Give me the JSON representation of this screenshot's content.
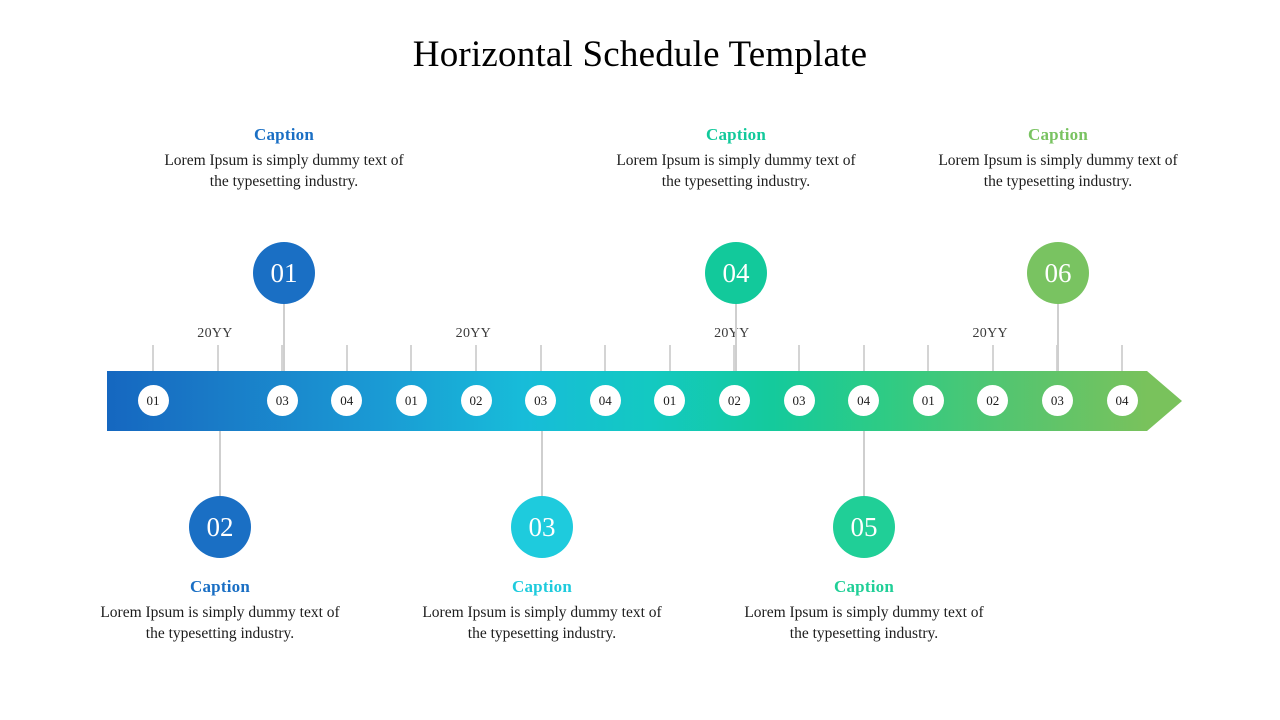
{
  "title": "Horizontal Schedule Template",
  "colors": {
    "node_01": "#1a6fc4",
    "node_02": "#1a6fc4",
    "node_03": "#1ecbdd",
    "node_04": "#12c99b",
    "node_05": "#20cf97",
    "node_06": "#79c361",
    "bar_start": "#1567c0",
    "bar_mid": "#13c9c2",
    "bar_end": "#79c25c",
    "tick": "#d4d4d4",
    "stem": "#cfcfcf"
  },
  "timeline": {
    "year_labels": [
      "20YY",
      "20YY",
      "20YY",
      "20YY"
    ],
    "bar_markers": [
      "01",
      "03",
      "04",
      "01",
      "02",
      "03",
      "04",
      "01",
      "02",
      "03",
      "04",
      "01",
      "02",
      "03",
      "04"
    ]
  },
  "nodes": [
    {
      "number": "01",
      "position": "above",
      "color": "#1a6fc4",
      "caption_title": "Caption",
      "caption_body": "Lorem Ipsum is simply dummy text of the typesetting industry."
    },
    {
      "number": "02",
      "position": "below",
      "color": "#1a6fc4",
      "caption_title": "Caption",
      "caption_body": "Lorem Ipsum is simply dummy text of the typesetting industry."
    },
    {
      "number": "03",
      "position": "below",
      "color": "#1ecbdd",
      "caption_title": "Caption",
      "caption_body": "Lorem Ipsum is simply dummy text of the typesetting industry."
    },
    {
      "number": "04",
      "position": "above",
      "color": "#12c99b",
      "caption_title": "Caption",
      "caption_body": "Lorem Ipsum is simply dummy text of the typesetting industry."
    },
    {
      "number": "05",
      "position": "below",
      "color": "#20cf97",
      "caption_title": "Caption",
      "caption_body": "Lorem Ipsum is simply dummy text of the typesetting industry."
    },
    {
      "number": "06",
      "position": "above",
      "color": "#79c361",
      "caption_title": "Caption",
      "caption_body": "Lorem Ipsum is simply dummy text of the typesetting industry."
    }
  ]
}
